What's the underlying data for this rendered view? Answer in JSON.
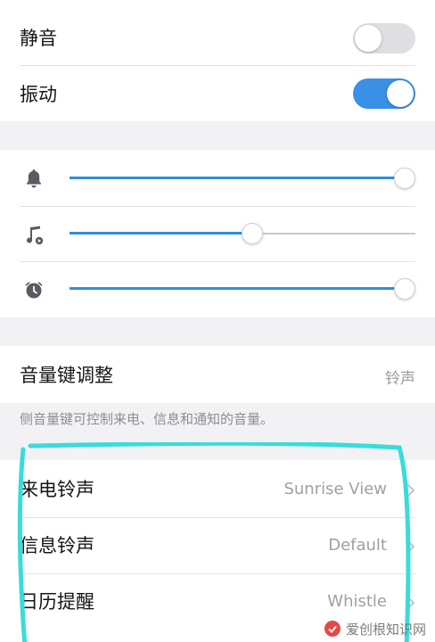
{
  "toggles": {
    "mute": {
      "label": "静音",
      "on": false
    },
    "vibrate": {
      "label": "振动",
      "on": true
    }
  },
  "volume": {
    "ringer_icon": "bell-icon",
    "media_icon": "music-note-icon",
    "alarm_icon": "alarm-clock-icon",
    "ringer_level": 1.0,
    "media_level": 0.53,
    "alarm_level": 1.0
  },
  "volume_keys": {
    "label": "音量键调整",
    "value": "铃声",
    "description": "侧音量键可控制来电、信息和通知的音量。"
  },
  "ringtones": [
    {
      "label": "来电铃声",
      "value": "Sunrise View"
    },
    {
      "label": "信息铃声",
      "value": "Default"
    },
    {
      "label": "日历提醒",
      "value": "Whistle"
    }
  ],
  "watermark": {
    "text": "爱创根知识网"
  },
  "colors": {
    "accent": "#3a8fe6",
    "slider_fill": "#2f8fd8",
    "highlight": "#38dcdc",
    "background": "#f2f2f4"
  }
}
